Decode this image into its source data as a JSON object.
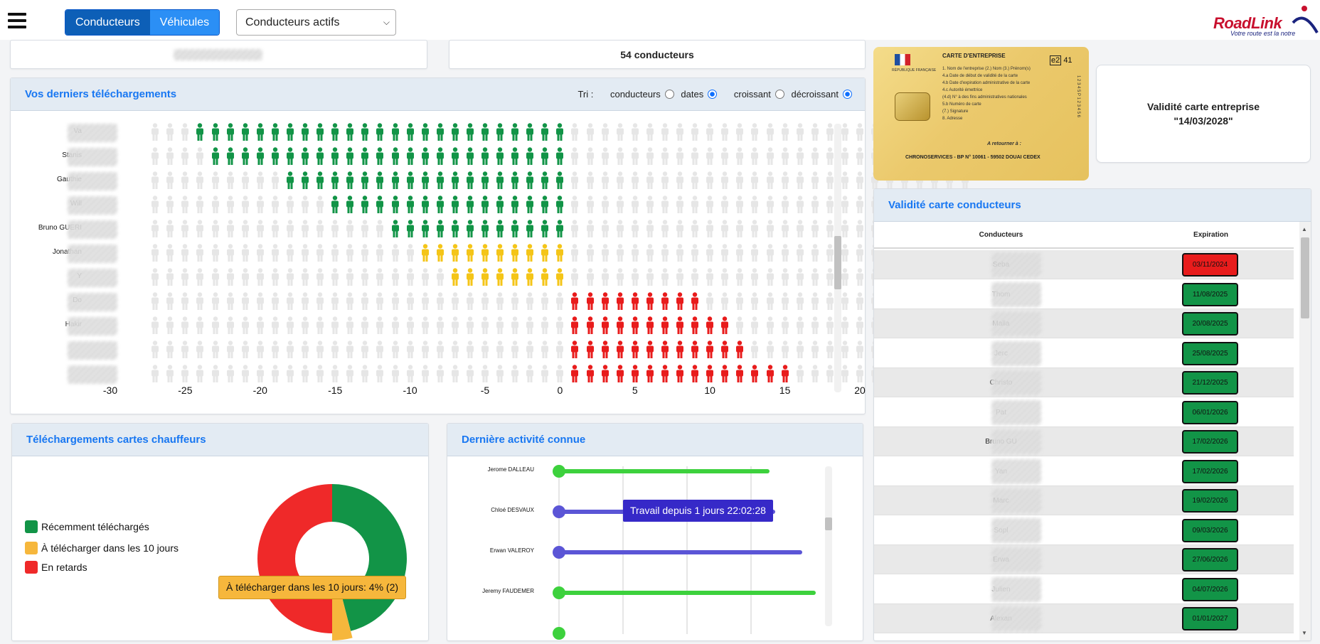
{
  "toolbar": {
    "menu_icon": "hamburger-icon",
    "segment_drivers": "Conducteurs",
    "segment_vehicles": "Véhicules",
    "filter_value": "Conducteurs actifs",
    "logo_text": "RoadLink",
    "logo_tagline": "Votre route est la notre"
  },
  "summary": {
    "driver_count": "54 conducteurs"
  },
  "downloads": {
    "title": "Vos derniers téléchargements",
    "sort_label": "Tri :",
    "opt_drivers": "conducteurs",
    "opt_dates": "dates",
    "opt_asc": "croissant",
    "opt_desc": "décroissant",
    "rows": [
      "Va",
      "Stanis",
      "Gauthie",
      "Will",
      "Bruno GUERI",
      "Jonathan",
      "Y",
      "Do",
      "Hakir",
      "",
      ""
    ],
    "colors": {
      "green": "#129447",
      "yellow": "#f4c518",
      "red": "#e81c1c",
      "grey": "#e6e6e6"
    }
  },
  "chart_data": {
    "type": "scatter",
    "title": "Vos derniers téléchargements",
    "xlim": [
      -30,
      30
    ],
    "x_ticks": [
      "-30",
      "-25",
      "-20",
      "-15",
      "-10",
      "-5",
      "0",
      "5",
      "10",
      "15",
      "20",
      "25",
      "30"
    ],
    "series": [
      {
        "name": "Va",
        "status": "green",
        "from": -24,
        "to": 0
      },
      {
        "name": "Stanis",
        "status": "green",
        "from": -23,
        "to": 0
      },
      {
        "name": "Gauthie",
        "status": "green",
        "from": -18,
        "to": 0
      },
      {
        "name": "Will",
        "status": "green",
        "from": -15,
        "to": 0
      },
      {
        "name": "Bruno GUERI",
        "status": "green",
        "from": -11,
        "to": 0
      },
      {
        "name": "Jonathan",
        "status": "yellow",
        "from": -9,
        "to": 0
      },
      {
        "name": "Y",
        "status": "yellow",
        "from": -7,
        "to": 0
      },
      {
        "name": "Do",
        "status": "red",
        "from": 1,
        "to": 9
      },
      {
        "name": "Hakir",
        "status": "red",
        "from": 1,
        "to": 11
      },
      {
        "name": "",
        "status": "red",
        "from": 1,
        "to": 12
      },
      {
        "name": "",
        "status": "red",
        "from": 1,
        "to": 15
      }
    ]
  },
  "company_card": {
    "card_title": "CARTE D'ENTREPRISE",
    "republic": "RÉPUBLIQUE FRANÇAISE",
    "class_code": "e2",
    "class_num": "41",
    "lines": [
      "1.   Nom de l'entreprise  (2.) Nom       (3.) Prénom(s)",
      "4.a  Date de début de validité de la carte",
      "4.b  Date d'expiration administrative de la carte",
      "4.c  Autorité émettrice",
      "(4.d) N° à des fins administratives nationales",
      "5.b  Numéro de carte",
      "(7.)  Signature",
      "8.    Adresse"
    ],
    "return_to": "A retourner à :",
    "address": "CHRONOSERVICES - BP N° 10061 - 59502 DOUAI CEDEX",
    "serial": "1 2 3 4 5 P 1 2 3 4 5 6",
    "validity_title": "Validité carte entreprise",
    "validity_date": "\"14/03/2028\""
  },
  "driver_cards": {
    "title": "Validité carte conducteurs",
    "col_driver": "Conducteurs",
    "col_expiration": "Expiration",
    "rows": [
      {
        "name": "Seba",
        "date": "03/11/2024",
        "color": "#e81c1c"
      },
      {
        "name": "Thom",
        "date": "11/08/2025",
        "color": "#129447"
      },
      {
        "name": "Malla",
        "date": "20/08/2025",
        "color": "#129447"
      },
      {
        "name": "Jerc",
        "date": "25/08/2025",
        "color": "#129447"
      },
      {
        "name": "Christo",
        "date": "21/12/2025",
        "color": "#129447"
      },
      {
        "name": "Pat",
        "date": "06/01/2026",
        "color": "#129447"
      },
      {
        "name": "Bruno GU",
        "date": "17/02/2026",
        "color": "#129447"
      },
      {
        "name": "Yan",
        "date": "17/02/2026",
        "color": "#129447"
      },
      {
        "name": "Marc",
        "date": "19/02/2026",
        "color": "#129447"
      },
      {
        "name": "Sopl",
        "date": "09/03/2026",
        "color": "#129447"
      },
      {
        "name": "Erwa",
        "date": "27/06/2026",
        "color": "#129447"
      },
      {
        "name": "Julien",
        "date": "04/07/2026",
        "color": "#129447"
      },
      {
        "name": "Alexan",
        "date": "01/01/2027",
        "color": "#129447"
      }
    ]
  },
  "downloads_pie": {
    "title": "Téléchargements cartes chauffeurs",
    "legend": [
      {
        "label": "Récemment téléchargés",
        "color": "#129447"
      },
      {
        "label": "À télécharger dans les 10 jours",
        "color": "#f6b73c"
      },
      {
        "label": "En retards",
        "color": "#ef2929"
      }
    ],
    "tooltip": "À télécharger dans les 10 jours: 4% (2)",
    "values": [
      {
        "label": "Récemment téléchargés",
        "percent": 46
      },
      {
        "label": "À télécharger dans les 10 jours",
        "percent": 4
      },
      {
        "label": "En retards",
        "percent": 50
      }
    ]
  },
  "activity": {
    "title": "Dernière activité connue",
    "drivers": [
      "Jerome DALLEAU",
      "Chloé DESVAUX",
      "Erwan VALEROY",
      "Jeremy FAUDEMER"
    ],
    "tooltip": "Travail depuis 1 jours 22:02:28",
    "colors": {
      "green": "#3dd13d",
      "blue": "#5b55d6"
    }
  }
}
